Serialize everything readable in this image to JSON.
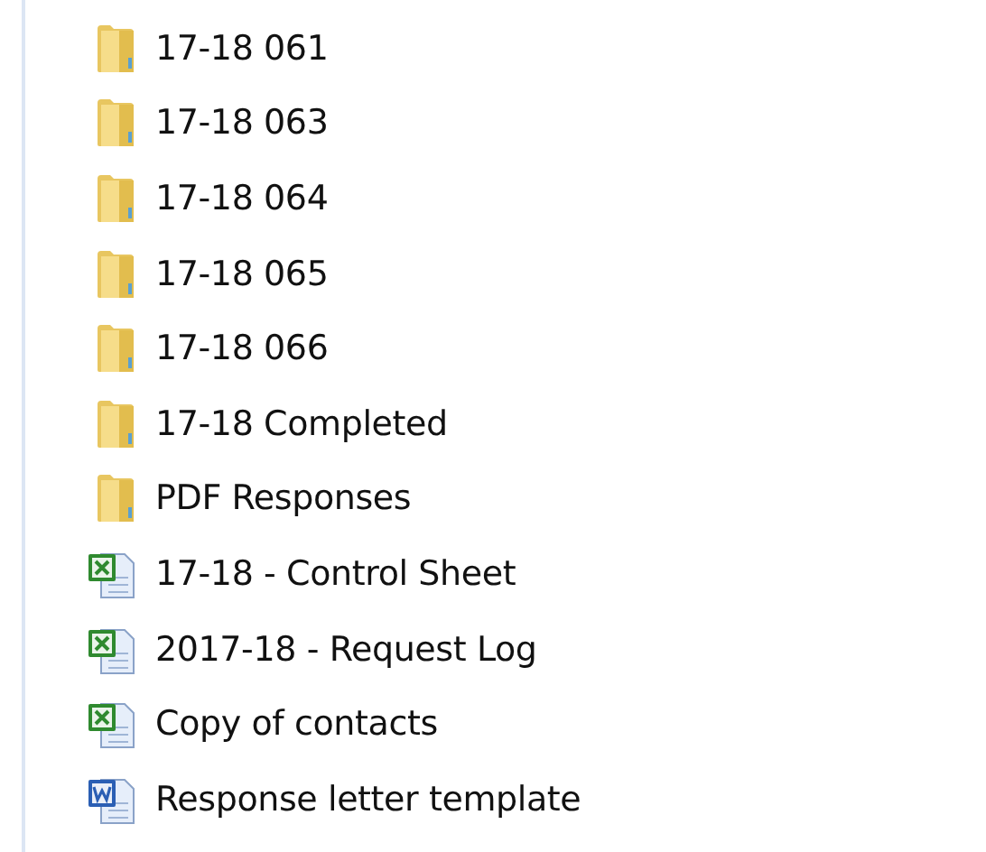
{
  "items": [
    {
      "kind": "folder",
      "name": "17-18 061"
    },
    {
      "kind": "folder",
      "name": "17-18 063"
    },
    {
      "kind": "folder",
      "name": "17-18 064"
    },
    {
      "kind": "folder",
      "name": "17-18 065"
    },
    {
      "kind": "folder",
      "name": "17-18 066"
    },
    {
      "kind": "folder",
      "name": "17-18 Completed"
    },
    {
      "kind": "folder",
      "name": "PDF Responses"
    },
    {
      "kind": "excel",
      "name": "17-18 - Control Sheet"
    },
    {
      "kind": "excel",
      "name": "2017-18 - Request Log"
    },
    {
      "kind": "excel",
      "name": "Copy of contacts"
    },
    {
      "kind": "word",
      "name": "Response letter template"
    }
  ]
}
